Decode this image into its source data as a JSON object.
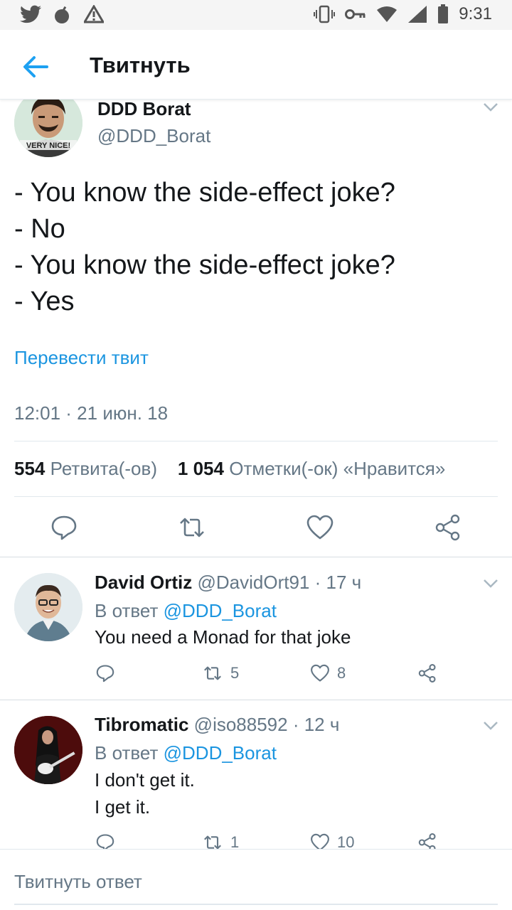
{
  "status_bar": {
    "time": "9:31"
  },
  "header": {
    "title": "Твитнуть"
  },
  "tweet": {
    "author_name": "DDD Borat",
    "author_handle": "@DDD_Borat",
    "avatar_caption": "VERY NICE!",
    "lines": [
      "- You know the side-effect joke?",
      "- No",
      "- You know the side-effect joke?",
      "- Yes"
    ],
    "translate_label": "Перевести твит",
    "timestamp": "12:01 · 21 июн. 18",
    "retweets_count": "554",
    "retweets_label": "Ретвита(-ов)",
    "likes_count": "1 054",
    "likes_label": "Отметки(-ок) «Нравится»"
  },
  "replies": [
    {
      "name": "David Ortiz",
      "meta": "@DavidOrt91 · 17 ч",
      "reply_prefix": "В ответ",
      "reply_handle": "@DDD_Borat",
      "lines": [
        "You need a Monad for that joke"
      ],
      "retweets": "5",
      "likes": "8"
    },
    {
      "name": "Tibromatic",
      "meta": "@iso88592 · 12 ч",
      "reply_prefix": "В ответ",
      "reply_handle": "@DDD_Borat",
      "lines": [
        "I don't get it.",
        "I get it."
      ],
      "retweets": "1",
      "likes": "10"
    }
  ],
  "compose": {
    "placeholder": "Твитнуть ответ"
  },
  "colors": {
    "accent": "#1b95e0",
    "text": "#14171a",
    "secondary": "#657786"
  }
}
